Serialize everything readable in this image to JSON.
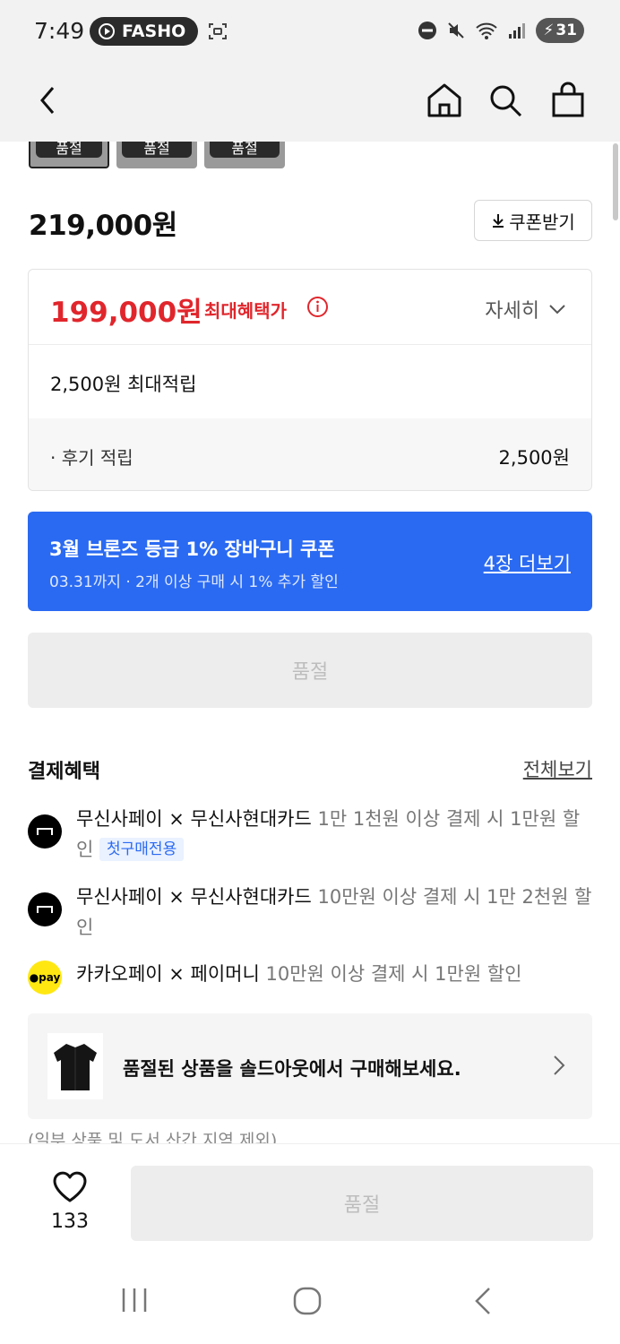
{
  "status_bar": {
    "time": "7:49",
    "app_pill": "FASHO",
    "battery": "31"
  },
  "thumbnails": [
    "품절",
    "품절",
    "품절"
  ],
  "product": {
    "price": "219,000원",
    "coupon_button": "쿠폰받기"
  },
  "benefit": {
    "max_price": "199,000원",
    "max_label": "최대혜택가",
    "detail_link": "자세히",
    "points": "2,500원 최대적립",
    "review_label": "· 후기 적립",
    "review_value": "2,500원"
  },
  "coupon_banner": {
    "title": "3월 브론즈 등급 1% 장바구니 쿠폰",
    "subtitle": "03.31까지 · 2개 이상 구매 시 1% 추가 할인",
    "more": "4장 더보기"
  },
  "soldout_button": "품절",
  "payment": {
    "title": "결제혜택",
    "see_all": "전체보기",
    "items": [
      {
        "name": "무신사페이 × 무신사현대카드",
        "desc": "1만 1천원 이상 결제 시 1만원 할인",
        "tag": "첫구매전용"
      },
      {
        "name": "무신사페이 × 무신사현대카드",
        "desc": "10만원 이상 결제 시 1만 2천원 할인"
      },
      {
        "name": "카카오페이 × 페이머니",
        "desc": "10만원 이상 결제 시 1만원 할인",
        "logo_text": "●pay"
      }
    ]
  },
  "soldout_banner": {
    "text": "품절된 상품을 솔드아웃에서 구매해보세요."
  },
  "partial_text": "(일부 상품 및 도서 산간 지역 제외)",
  "bottom": {
    "like_count": "133",
    "soldout": "품절"
  },
  "colors": {
    "accent_blue": "#2a6af2",
    "sale_red": "#e0262c",
    "kakao_yellow": "#ffe812"
  }
}
